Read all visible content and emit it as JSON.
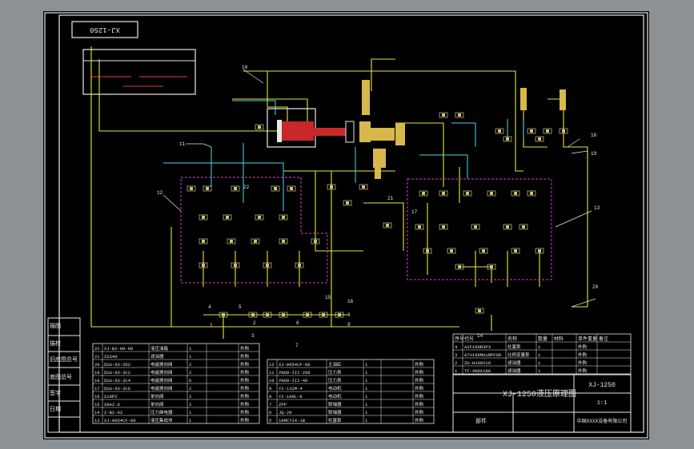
{
  "drawing": {
    "code": "XJ-1250",
    "title": "XJ-1250液压原理图",
    "code_label": "XJ-1250",
    "scale": "1:1",
    "company": "中国XXXX设备有限公司",
    "mark": "部件"
  },
  "left_panel": [
    "描图",
    "描校",
    "旧底图总号",
    "底图总号",
    "签字",
    "日期"
  ],
  "callouts": [
    "10",
    "11",
    "12",
    "13",
    "1",
    "4",
    "2",
    "3",
    "5",
    "6",
    "7",
    "8",
    "9",
    "14",
    "15",
    "16",
    "17",
    "18",
    "19",
    "20",
    "21",
    "22"
  ],
  "bom_left": [
    [
      "22",
      "XJ-B2-00-00",
      "液压油箱",
      "1",
      "",
      "外购"
    ],
    [
      "21",
      "ZSS40",
      "滤油器",
      "1",
      "",
      "外购"
    ],
    [
      "20",
      "DSG-03-2D2",
      "电磁换向阀",
      "2",
      "",
      "外购"
    ],
    [
      "19",
      "DSG-03-3C2",
      "电磁换向阀",
      "2",
      "",
      "外购"
    ],
    [
      "18",
      "DSG-03-3C4",
      "电磁换向阀",
      "6",
      "",
      "外购"
    ],
    [
      "17",
      "DSG-03-3C6",
      "电磁换向阀",
      "2",
      "",
      "外购"
    ],
    [
      "16",
      "S10P2",
      "单向阀",
      "2",
      "",
      "外购"
    ],
    [
      "15",
      "S8A2.0",
      "单向阀",
      "2",
      "",
      "外购"
    ],
    [
      "14",
      "Z-B2-03",
      "压力继电器",
      "1",
      "",
      "外购"
    ],
    [
      "13",
      "XJ-0054CF-00",
      "液压集成块",
      "1",
      "",
      "外购"
    ]
  ],
  "bom_mid": [
    [
      "12",
      "XJ-0054CF-00",
      "主油缸",
      "1",
      "",
      "外购"
    ],
    [
      "11",
      "YN60-III-250",
      "压力表",
      "1",
      "",
      "外购"
    ],
    [
      "10",
      "YN60-III-40",
      "压力表",
      "1",
      "",
      "外购"
    ],
    [
      "9",
      "Y2-132M-4",
      "电动机",
      "1",
      "",
      "外购"
    ],
    [
      "8",
      "Y2-100L-6",
      "电动机",
      "1",
      "",
      "外购"
    ],
    [
      "7",
      "ZPP",
      "联轴器",
      "1",
      "",
      "外购"
    ],
    [
      "6",
      "JQ-20",
      "联轴器",
      "1",
      "",
      "外购"
    ],
    [
      "5",
      "10MCY14-1B",
      "柱塞泵",
      "1",
      "",
      "外购"
    ]
  ],
  "bom_right": [
    [
      "4",
      "A2F160R3P3",
      "柱塞泵",
      "1",
      "",
      "外购"
    ],
    [
      "3",
      "A7V160MA1RPF00",
      "比例变量泵",
      "1",
      "",
      "外购"
    ],
    [
      "2",
      "ZU-H160X10",
      "滤油器",
      "1",
      "",
      "外购"
    ],
    [
      "1",
      "TF-400X180",
      "滤油器",
      "1",
      "",
      "外购"
    ]
  ],
  "bom_header": [
    "序号",
    "代号",
    "名称",
    "数量",
    "材料",
    "单件重量",
    "备注"
  ]
}
